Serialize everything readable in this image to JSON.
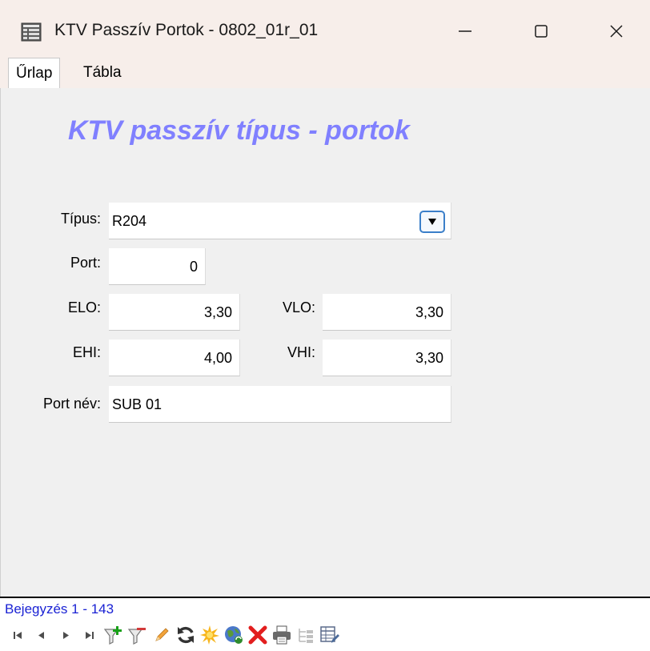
{
  "window": {
    "title": "KTV Passzív Portok - 0802_01r_01"
  },
  "tabs": [
    {
      "label": "Űrlap"
    },
    {
      "label": "Tábla"
    }
  ],
  "form": {
    "title": "KTV passzív típus - portok",
    "tipus": {
      "label": "Típus:",
      "value": "R204"
    },
    "port": {
      "label": "Port:",
      "value": "0"
    },
    "elo": {
      "label": "ELO:",
      "value": "3,30"
    },
    "vlo": {
      "label": "VLO:",
      "value": "3,30"
    },
    "ehi": {
      "label": "EHI:",
      "value": "4,00"
    },
    "vhi": {
      "label": "VHI:",
      "value": "3,30"
    },
    "port_nev": {
      "label": "Port név:",
      "value": "SUB 01"
    }
  },
  "status": {
    "record_count": "Bejegyzés 1 - 143"
  },
  "icons": {
    "app": "table-icon",
    "minimize": "minimize-icon",
    "maximize": "maximize-icon",
    "close": "close-icon",
    "dropdown": "chevron-down-icon",
    "nav": [
      "first-record-icon",
      "prev-record-icon",
      "next-record-icon",
      "last-record-icon",
      "add-filter-icon",
      "remove-filter-icon",
      "edit-icon",
      "refresh-icon",
      "new-icon",
      "web-icon",
      "delete-icon",
      "print-icon",
      "tree-icon",
      "table-edit-icon"
    ]
  },
  "colors": {
    "form_title": "#8080ff",
    "record_count": "#1a22d4",
    "title_bar": "#f7eeea",
    "dropdown_border": "#3b7fc9"
  }
}
